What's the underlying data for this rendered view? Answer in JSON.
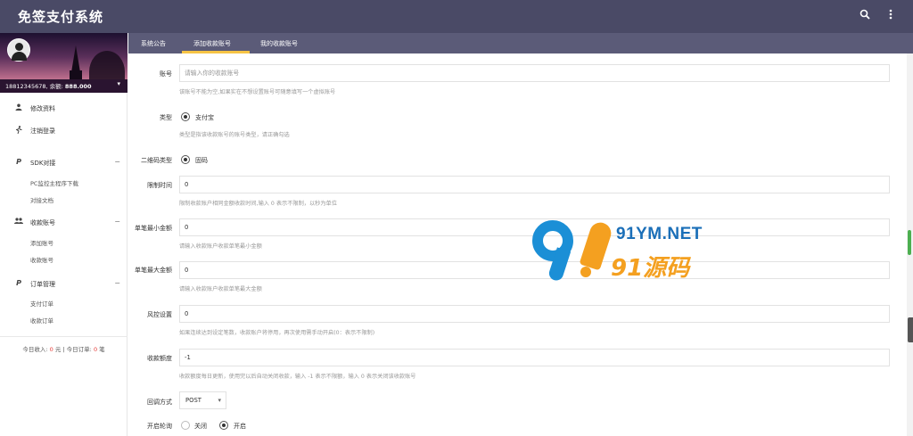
{
  "app": {
    "title": "免签支付系统"
  },
  "topbar": {
    "search_icon": "search-icon",
    "more_icon": "more-vert-icon"
  },
  "user": {
    "info_prefix": "18812345678, 余额:",
    "balance": "888.000"
  },
  "sidebar": {
    "items": [
      {
        "label": "修改资料",
        "icon": "person-icon"
      },
      {
        "label": "注销登录",
        "icon": "run-icon"
      },
      {
        "label": "SDK对接",
        "icon": "paypal-icon",
        "collapse": "−",
        "children": [
          "PC监控主程序下载",
          "对接文档"
        ]
      },
      {
        "label": "收款账号",
        "icon": "group-icon",
        "collapse": "−",
        "children": [
          "添加账号",
          "收款账号"
        ]
      },
      {
        "label": "订单管理",
        "icon": "paypal-icon",
        "collapse": "−",
        "children": [
          "支付订单",
          "收款订单"
        ]
      }
    ],
    "stats": {
      "income_label": "今日收入:",
      "income_value": "0",
      "income_unit": "元",
      "sep": " | ",
      "orders_label": "今日订单:",
      "orders_value": "0",
      "orders_unit": "笔"
    }
  },
  "tabs": [
    {
      "label": "系统公告",
      "active": false
    },
    {
      "label": "添加收款账号",
      "active": true
    },
    {
      "label": "我的收款账号",
      "active": false
    }
  ],
  "form": {
    "account": {
      "label": "账号",
      "placeholder": "请输入你的收款账号",
      "help": "该账号不能为空,如果实在不想设置账号可随意填写一个虚拟账号"
    },
    "type": {
      "label": "类型",
      "option": "支付宝",
      "help": "类型是指该收款账号的账号类型，请正确勾选"
    },
    "qr_type": {
      "label": "二维码类型",
      "option": "固码"
    },
    "time_limit": {
      "label": "限制时间",
      "value": "0",
      "help": "限制收款账户相同金额收款时间,输入 0 表示不限制，以秒为单位"
    },
    "min_amount": {
      "label": "单笔最小金额",
      "value": "0",
      "help": "请输入收款账户收款单笔最小金额"
    },
    "max_amount": {
      "label": "单笔最大金额",
      "value": "0",
      "help": "请输入收款账户收款单笔最大金额"
    },
    "risk": {
      "label": "风控设置",
      "value": "0",
      "help": "如果连续达到设定笔数，收款账户将停用，再次使用需手动开启(0：表示不限制)"
    },
    "quota": {
      "label": "收款额度",
      "value": "-1",
      "help": "收款额度每日更新，使用完以后自动关闭收款，输入 -1 表示不限额，输入 0 表示关闭该收款账号"
    },
    "callback": {
      "label": "回调方式",
      "value": "POST"
    },
    "polling": {
      "label": "开启轮询",
      "off": "关闭",
      "on": "开启"
    }
  },
  "watermark": {
    "site": "91YM.NET",
    "brand": "91源码"
  }
}
